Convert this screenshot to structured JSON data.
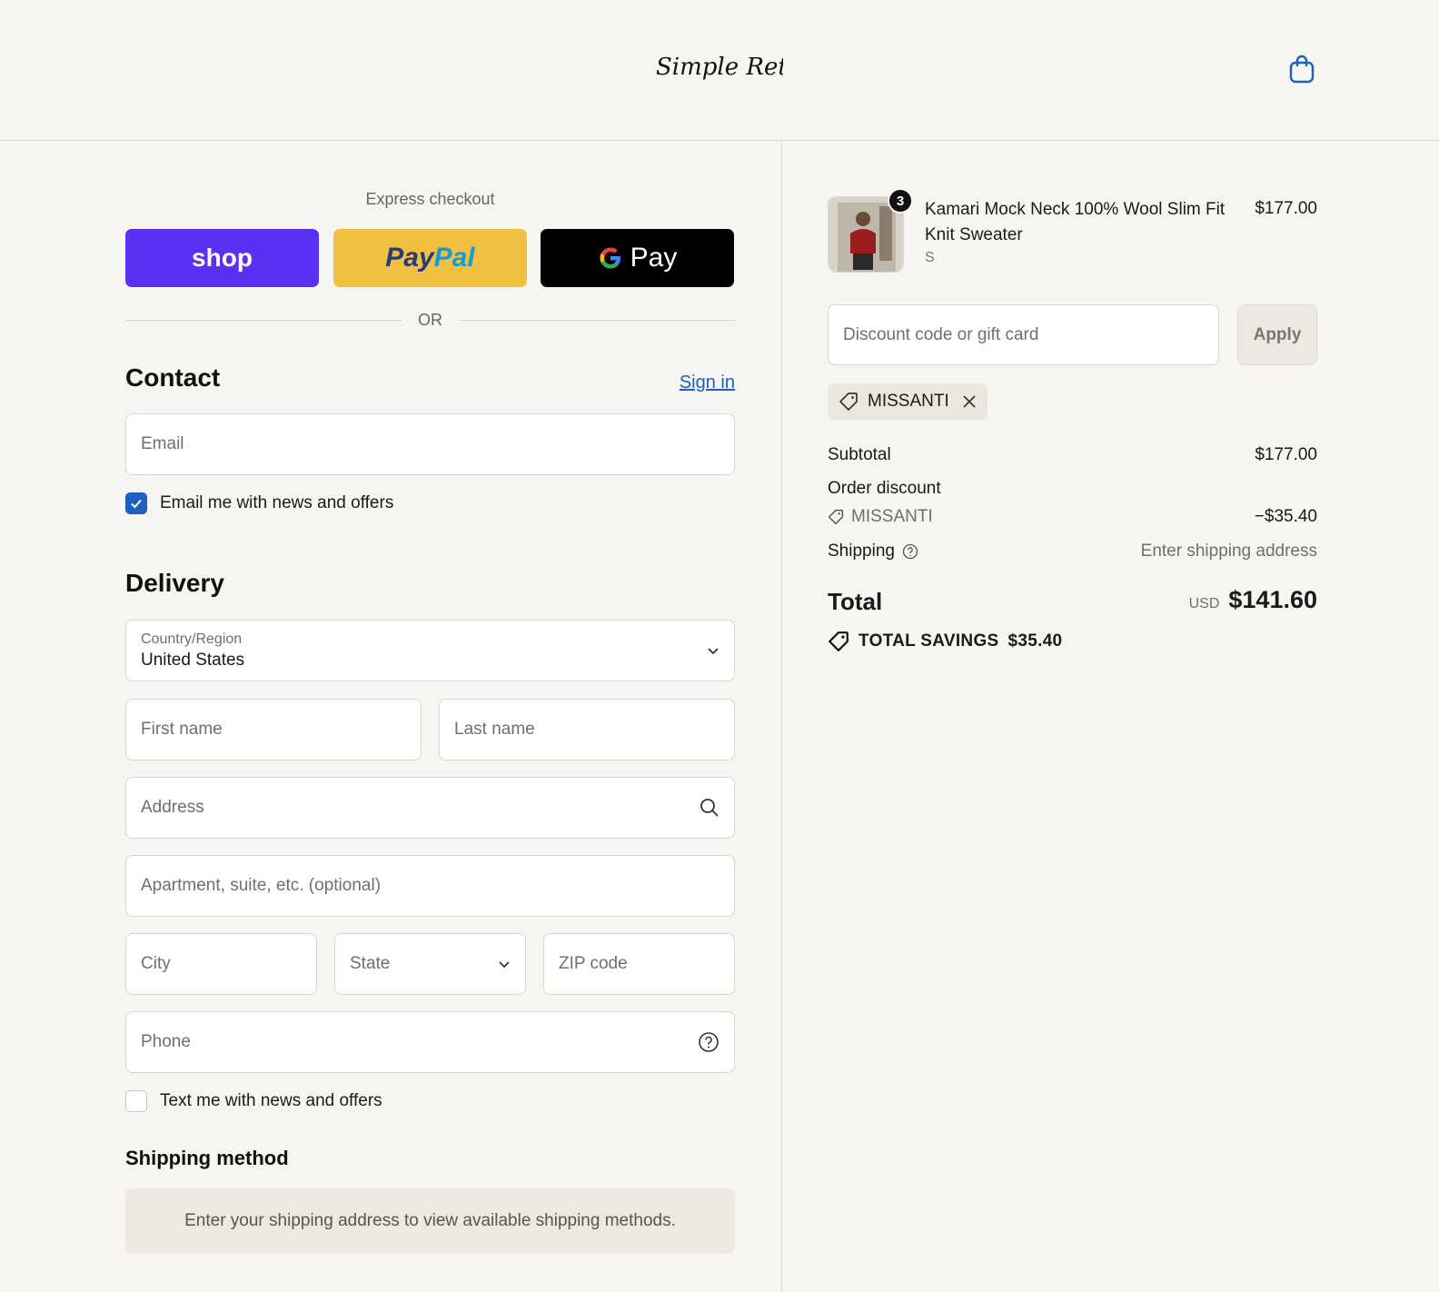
{
  "header": {
    "logo_text": "Simple Retro",
    "cart_icon": "shopping-bag-icon"
  },
  "express": {
    "title": "Express checkout",
    "shop_label": "shop",
    "paypal_label_1": "Pay",
    "paypal_label_2": "Pal",
    "gpay_label": "Pay",
    "or_label": "OR"
  },
  "contact": {
    "heading": "Contact",
    "sign_in": "Sign in",
    "email_placeholder": "Email",
    "news_checkbox_label": "Email me with news and offers",
    "news_checked": true
  },
  "delivery": {
    "heading": "Delivery",
    "country_label": "Country/Region",
    "country_value": "United States",
    "first_name_placeholder": "First name",
    "last_name_placeholder": "Last name",
    "address_placeholder": "Address",
    "apartment_placeholder": "Apartment, suite, etc. (optional)",
    "city_placeholder": "City",
    "state_placeholder": "State",
    "zip_placeholder": "ZIP code",
    "phone_placeholder": "Phone",
    "sms_checkbox_label": "Text me with news and offers",
    "sms_checked": false
  },
  "shipping_method": {
    "heading": "Shipping method",
    "notice": "Enter your shipping address to view available shipping methods."
  },
  "order": {
    "item": {
      "quantity": "3",
      "name": "Kamari Mock Neck 100% Wool Slim Fit Knit Sweater",
      "variant": "S",
      "price": "$177.00"
    },
    "discount_placeholder": "Discount code or gift card",
    "apply_label": "Apply",
    "applied_code": "MISSANTI",
    "subtotal_label": "Subtotal",
    "subtotal_value": "$177.00",
    "order_discount_label": "Order discount",
    "discount_code": "MISSANTI",
    "discount_value": "−$35.40",
    "shipping_label": "Shipping",
    "shipping_value": "Enter shipping address",
    "total_label": "Total",
    "currency": "USD",
    "total_value": "$141.60",
    "savings_label": "TOTAL SAVINGS",
    "savings_value": "$35.40"
  },
  "colors": {
    "background": "#f6f5f1",
    "shop_pay": "#5a31f4",
    "paypal": "#f2c040",
    "gpay": "#000000",
    "link": "#1f5fc2"
  }
}
